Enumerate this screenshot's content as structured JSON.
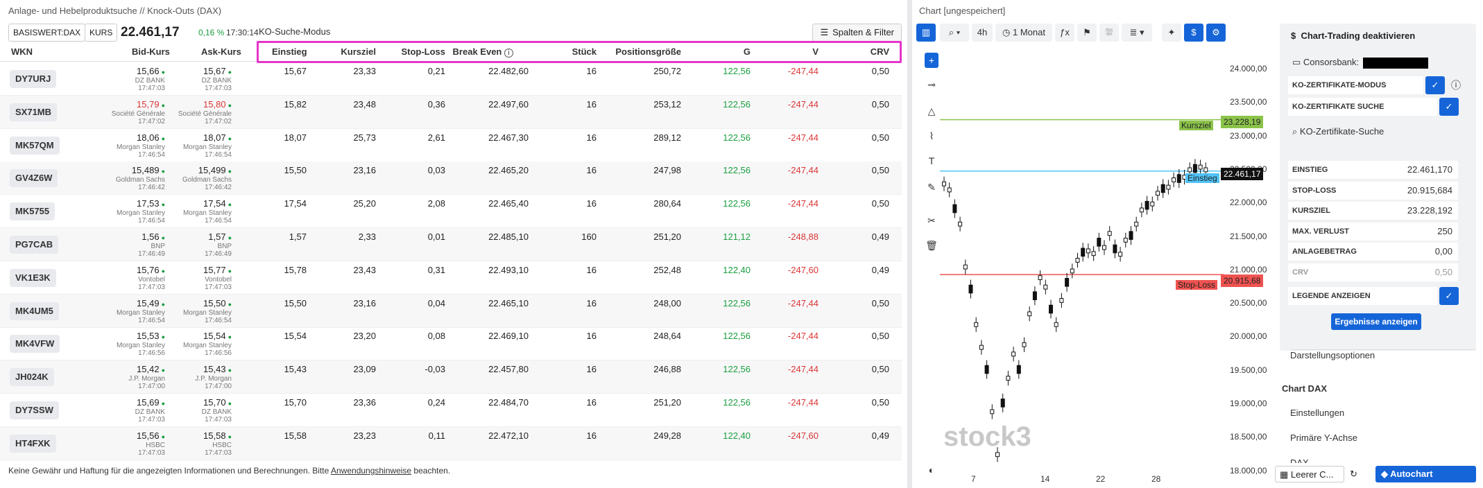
{
  "left": {
    "title": "Anlage- und Hebelproduktsuche // Knock-Outs (DAX)",
    "basiswert": "BASISWERT:DAX",
    "kurs_label": "KURS",
    "kurs_value": "22.461,17",
    "kurs_change": "0,16 %",
    "kurs_time": "17:30:14",
    "mode": "KO-Suche-Modus",
    "filter_label": "Spalten & Filter",
    "columns": [
      "WKN",
      "Bid-Kurs",
      "Ask-Kurs",
      "Einstieg",
      "Kursziel",
      "Stop-Loss",
      "Break Even",
      "Stück",
      "Positionsgröße",
      "G",
      "V",
      "CRV"
    ],
    "rows": [
      {
        "wkn": "DY7URJ",
        "bid": "15,66",
        "bid_iss": "DZ BANK",
        "bid_t": "17:47:03",
        "ask": "15,67",
        "ask_iss": "DZ BANK",
        "ask_t": "17:47:03",
        "ein": "15,67",
        "kz": "23,33",
        "sl": "0,21",
        "be": "22.482,60",
        "st": "16",
        "pg": "250,72",
        "g": "122,56",
        "v": "-247,44",
        "crv": "0,50",
        "bidred": false
      },
      {
        "wkn": "SX71MB",
        "bid": "15,79",
        "bid_iss": "Société Générale",
        "bid_t": "17:47:02",
        "ask": "15,80",
        "ask_iss": "Société Générale",
        "ask_t": "17:47:02",
        "ein": "15,82",
        "kz": "23,48",
        "sl": "0,36",
        "be": "22.497,60",
        "st": "16",
        "pg": "253,12",
        "g": "122,56",
        "v": "-247,44",
        "crv": "0,50",
        "bidred": true
      },
      {
        "wkn": "MK57QM",
        "bid": "18,06",
        "bid_iss": "Morgan Stanley",
        "bid_t": "17:46:54",
        "ask": "18,07",
        "ask_iss": "Morgan Stanley",
        "ask_t": "17:46:54",
        "ein": "18,07",
        "kz": "25,73",
        "sl": "2,61",
        "be": "22.467,30",
        "st": "16",
        "pg": "289,12",
        "g": "122,56",
        "v": "-247,44",
        "crv": "0,50",
        "bidred": false
      },
      {
        "wkn": "GV4Z6W",
        "bid": "15,489",
        "bid_iss": "Goldman Sachs",
        "bid_t": "17:46:42",
        "ask": "15,499",
        "ask_iss": "Goldman Sachs",
        "ask_t": "17:46:42",
        "ein": "15,50",
        "kz": "23,16",
        "sl": "0,03",
        "be": "22.465,20",
        "st": "16",
        "pg": "247,98",
        "g": "122,56",
        "v": "-247,44",
        "crv": "0,50",
        "bidred": false
      },
      {
        "wkn": "MK5755",
        "bid": "17,53",
        "bid_iss": "Morgan Stanley",
        "bid_t": "17:46:54",
        "ask": "17,54",
        "ask_iss": "Morgan Stanley",
        "ask_t": "17:46:54",
        "ein": "17,54",
        "kz": "25,20",
        "sl": "2,08",
        "be": "22.465,40",
        "st": "16",
        "pg": "280,64",
        "g": "122,56",
        "v": "-247,44",
        "crv": "0,50",
        "bidred": false
      },
      {
        "wkn": "PG7CAB",
        "bid": "1,56",
        "bid_iss": "BNP",
        "bid_t": "17:46:49",
        "ask": "1,57",
        "ask_iss": "BNP",
        "ask_t": "17:46:49",
        "ein": "1,57",
        "kz": "2,33",
        "sl": "0,01",
        "be": "22.485,10",
        "st": "160",
        "pg": "251,20",
        "g": "121,12",
        "v": "-248,88",
        "crv": "0,49",
        "bidred": false
      },
      {
        "wkn": "VK1E3K",
        "bid": "15,76",
        "bid_iss": "Vontobel",
        "bid_t": "17:47:03",
        "ask": "15,77",
        "ask_iss": "Vontobel",
        "ask_t": "17:47:03",
        "ein": "15,78",
        "kz": "23,43",
        "sl": "0,31",
        "be": "22.493,10",
        "st": "16",
        "pg": "252,48",
        "g": "122,40",
        "v": "-247,60",
        "crv": "0,49",
        "bidred": false
      },
      {
        "wkn": "MK4UM5",
        "bid": "15,49",
        "bid_iss": "Morgan Stanley",
        "bid_t": "17:46:54",
        "ask": "15,50",
        "ask_iss": "Morgan Stanley",
        "ask_t": "17:46:54",
        "ein": "15,50",
        "kz": "23,16",
        "sl": "0,04",
        "be": "22.465,10",
        "st": "16",
        "pg": "248,00",
        "g": "122,56",
        "v": "-247,44",
        "crv": "0,50",
        "bidred": false
      },
      {
        "wkn": "MK4VFW",
        "bid": "15,53",
        "bid_iss": "Morgan Stanley",
        "bid_t": "17:46:56",
        "ask": "15,54",
        "ask_iss": "Morgan Stanley",
        "ask_t": "17:46:56",
        "ein": "15,54",
        "kz": "23,20",
        "sl": "0,08",
        "be": "22.469,10",
        "st": "16",
        "pg": "248,64",
        "g": "122,56",
        "v": "-247,44",
        "crv": "0,50",
        "bidred": false
      },
      {
        "wkn": "JH024K",
        "bid": "15,42",
        "bid_iss": "J.P. Morgan",
        "bid_t": "17:47:00",
        "ask": "15,43",
        "ask_iss": "J.P. Morgan",
        "ask_t": "17:47:00",
        "ein": "15,43",
        "kz": "23,09",
        "sl": "-0,03",
        "be": "22.457,80",
        "st": "16",
        "pg": "246,88",
        "g": "122,56",
        "v": "-247,44",
        "crv": "0,50",
        "bidred": false
      },
      {
        "wkn": "DY7SSW",
        "bid": "15,69",
        "bid_iss": "DZ BANK",
        "bid_t": "17:47:03",
        "ask": "15,70",
        "ask_iss": "DZ BANK",
        "ask_t": "17:47:03",
        "ein": "15,70",
        "kz": "23,36",
        "sl": "0,24",
        "be": "22.484,70",
        "st": "16",
        "pg": "251,20",
        "g": "122,56",
        "v": "-247,44",
        "crv": "0,50",
        "bidred": false
      },
      {
        "wkn": "HT4FXK",
        "bid": "15,56",
        "bid_iss": "HSBC",
        "bid_t": "17:47:03",
        "ask": "15,58",
        "ask_iss": "HSBC",
        "ask_t": "17:47:03",
        "ein": "15,58",
        "kz": "23,23",
        "sl": "0,11",
        "be": "22.472,10",
        "st": "16",
        "pg": "249,28",
        "g": "122,40",
        "v": "-247,60",
        "crv": "0,49",
        "bidred": false
      }
    ],
    "footer_pre": "Keine Gewähr und Haftung für die angezeigten Informationen und Berechnungen. Bitte ",
    "footer_link": "Anwendungshinweise",
    "footer_post": " beachten."
  },
  "chart": {
    "title": "Chart [ungespeichert]",
    "interval": "4h",
    "range": "1 Monat",
    "yticks": [
      "24.000,00",
      "23.500,00",
      "23.000,00",
      "22.500,00",
      "22.000,00",
      "21.500,00",
      "21.000,00",
      "20.500,00",
      "20.000,00",
      "19.500,00",
      "19.000,00",
      "18.500,00",
      "18.000,00"
    ],
    "xticks": [
      "7",
      "14",
      "22",
      "28"
    ],
    "kursziel_label": "Kursziel",
    "kursziel_value": "23.228,19",
    "einstieg_label": "Einstieg",
    "einstieg_value": "22.461,17",
    "stoploss_label": "Stop-Loss",
    "stoploss_value": "20.915,68",
    "watermark": "stock3",
    "colors": {
      "kursziel": "#8bc34a",
      "einstieg": "#4fc3f7",
      "stoploss": "#ef5350",
      "accent": "#1565d8"
    }
  },
  "panel": {
    "header": "Chart-Trading deaktivieren",
    "broker": "Consorsbank:",
    "ko_mode": "KO-ZERTIFIKATE-MODUS",
    "ko_search": "KO-ZERTIFIKATE SUCHE",
    "search_title": "KO-Zertifikate-Suche",
    "fields": [
      {
        "label": "EINSTIEG",
        "value": "22.461,170"
      },
      {
        "label": "STOP-LOSS",
        "value": "20.915,684"
      },
      {
        "label": "KURSZIEL",
        "value": "23.228,192"
      },
      {
        "label": "MAX. VERLUST",
        "value": "250"
      },
      {
        "label": "ANLAGEBETRAG",
        "value": "0,00"
      },
      {
        "label": "CRV",
        "value": "0,50"
      }
    ],
    "legend": "LEGENDE ANZEIGEN",
    "results_button": "Ergebnisse anzeigen",
    "display_options": "Darstellungsoptionen",
    "chart_dax": "Chart DAX",
    "settings": "Einstellungen",
    "primary_y": "Primäre Y-Achse",
    "dax": "DAX",
    "empty_chart": "Leerer C...",
    "autochart": "Autochart"
  }
}
